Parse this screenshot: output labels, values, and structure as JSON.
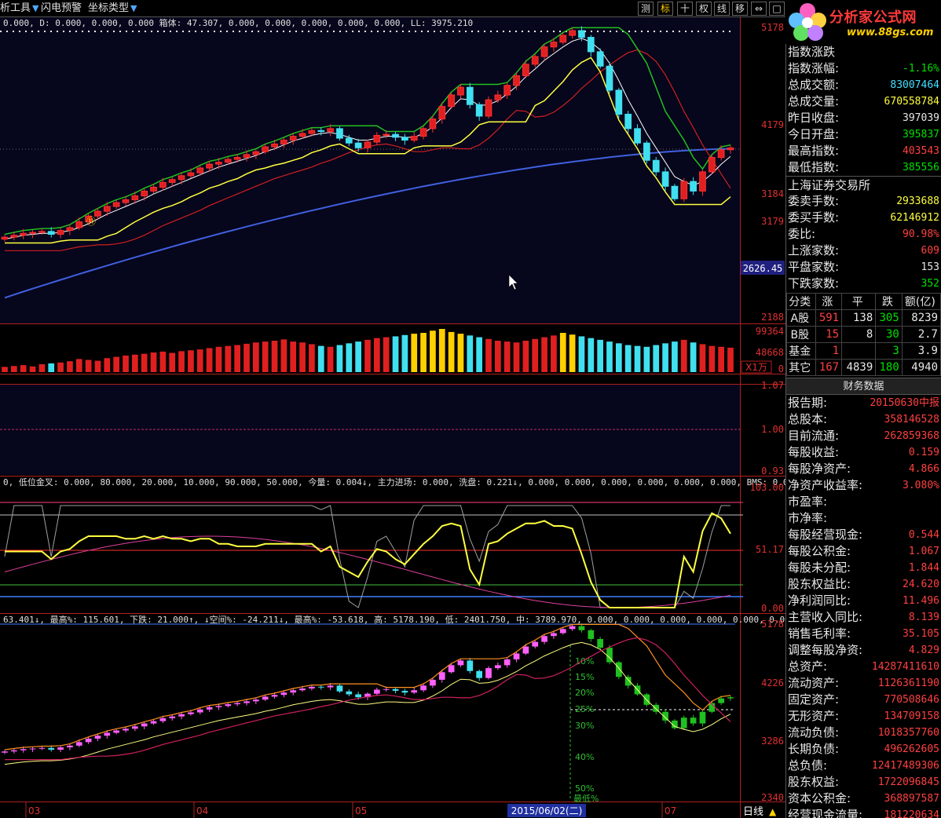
{
  "toolbar": {
    "items": [
      {
        "label": "析工具",
        "caret": true
      },
      {
        "label": "闪电预警",
        "caret": false
      },
      {
        "label": "坐标类型",
        "caret": true
      }
    ],
    "buttons": [
      "测",
      "标",
      "十",
      "权",
      "线",
      "移",
      "⇔",
      "□"
    ]
  },
  "logo": {
    "title": "分析家公式网",
    "url": "www.88gs.com"
  },
  "top_panel": {
    "rows": [
      {
        "label": "指数涨跌",
        "value": "",
        "color": "green"
      },
      {
        "label": "指数涨幅:",
        "value": "-1.16%",
        "color": "green"
      },
      {
        "label": "总成交额:",
        "value": "83007464",
        "color": "cyan"
      },
      {
        "label": "总成交量:",
        "value": "670558784",
        "color": "yel"
      },
      {
        "label": "昨日收盘:",
        "value": "397039",
        "color": "white"
      },
      {
        "label": "今日开盘:",
        "value": "395837",
        "color": "green"
      },
      {
        "label": "最高指数:",
        "value": "403543",
        "color": "red"
      },
      {
        "label": "最低指数:",
        "value": "385556",
        "color": "green"
      }
    ],
    "exchange": "上海证券交易所",
    "rows2": [
      {
        "label": "委卖手数:",
        "value": "2933688",
        "color": "yel"
      },
      {
        "label": "委买手数:",
        "value": "62146912",
        "color": "yel"
      },
      {
        "label": "委比:",
        "value": "90.98%",
        "color": "red"
      },
      {
        "label": "上涨家数:",
        "value": "609",
        "color": "red"
      },
      {
        "label": "平盘家数:",
        "value": "153",
        "color": "white"
      },
      {
        "label": "下跌家数:",
        "value": "352",
        "color": "green"
      }
    ]
  },
  "summary_table": {
    "headers": [
      "分类",
      "涨",
      "平",
      "跌",
      "额(亿)"
    ],
    "rows": [
      [
        "A股",
        "591",
        "138",
        "305",
        "8239"
      ],
      [
        "B股",
        "15",
        "8",
        "30",
        "2.7"
      ],
      [
        "基金",
        "1",
        "",
        "3",
        "3.9"
      ],
      [
        "其它",
        "167",
        "4839",
        "180",
        "4940"
      ]
    ]
  },
  "finance": {
    "tab": "财务数据",
    "rows": [
      {
        "label": "报告期:",
        "value": "20150630中报"
      },
      {
        "label": "总股本:",
        "value": "358146528"
      },
      {
        "label": "目前流通:",
        "value": "262859368"
      },
      {
        "label": "每股收益:",
        "value": "0.159"
      },
      {
        "label": "每股净资产:",
        "value": "4.866"
      },
      {
        "label": "净资产收益率:",
        "value": "3.080%"
      },
      {
        "label": "市盈率:",
        "value": ""
      },
      {
        "label": "市净率:",
        "value": ""
      },
      {
        "label": "每股经营现金:",
        "value": "0.544"
      },
      {
        "label": "每股公积金:",
        "value": "1.067"
      },
      {
        "label": "每股未分配:",
        "value": "1.844"
      },
      {
        "label": "股东权益比:",
        "value": "24.620"
      },
      {
        "label": "净利润同比:",
        "value": "11.496"
      },
      {
        "label": "主营收入同比:",
        "value": "8.139"
      },
      {
        "label": "销售毛利率:",
        "value": "35.105"
      },
      {
        "label": "调整每股净资:",
        "value": "4.829"
      },
      {
        "label": "总资产:",
        "value": "14287411610"
      },
      {
        "label": "流动资产:",
        "value": "1126361190"
      },
      {
        "label": "固定资产:",
        "value": "770508646"
      },
      {
        "label": "无形资产:",
        "value": "134709158"
      },
      {
        "label": "流动负债:",
        "value": "1018357760"
      },
      {
        "label": "长期负债:",
        "value": "496262605"
      },
      {
        "label": "总负债:",
        "value": "12417489306"
      },
      {
        "label": "股东权益:",
        "value": "1722096845"
      },
      {
        "label": "资本公积金:",
        "value": "368897587"
      },
      {
        "label": "经营现金流量:",
        "value": "181220634"
      }
    ]
  },
  "panes": {
    "main": {
      "info": "0.000, D: 0.000, 0.000, 0.000 箱体: 47.307, 0.000, 0.000, 0.000, 0.000, 0.000, LL: 3975.210",
      "y_labels": [
        "5178",
        "4179",
        "3184",
        "3179",
        "2188"
      ],
      "price_tag": "2626.45",
      "marker": "⑪"
    },
    "volume": {
      "y_labels": [
        "99364",
        "48668",
        "0"
      ],
      "unit": "X1万"
    },
    "ratio": {
      "y_labels": [
        "1.07",
        "1.00",
        "0.93"
      ]
    },
    "oscillator": {
      "info": "0, 低位金叉: 0.000, 80.000, 20.000, 10.000, 90.000, 50.000, 今量: 0.004↓, 主力进场: 0.000, 洗盘: 0.221↓, 0.000, 0.000, 0.000, 0.000, 0.000, 0.000, BMS: 0.000",
      "y_labels": [
        "103.00",
        "51.17",
        "0.00"
      ]
    },
    "lower": {
      "info": "63.401↓, 最高%: 115.601, 下跌: 21.000↑, ↓空间%: -24.211↓, 最高%: -53.618, 高: 5178.190, 低: 2401.750, 中: 3789.970, 0.000, 0.000, 0.000, 0.000, 0.000, 0.000, 0",
      "y_labels": [
        "5178",
        "4226",
        "3286",
        "2340"
      ],
      "pct_labels": [
        "10%",
        "15%",
        "20%",
        "25%",
        "30%",
        "40%",
        "50%",
        "最低%"
      ]
    }
  },
  "x_axis": {
    "labels": [
      "03",
      "04",
      "05",
      "07"
    ],
    "cursor_date": "2015/06/02(二)",
    "period": "日线"
  },
  "chart_data": {
    "type": "candlestick",
    "title": "",
    "y_range": [
      2188,
      5178
    ],
    "closes": [
      3020,
      3040,
      3060,
      3070,
      3080,
      3050,
      3090,
      3120,
      3180,
      3240,
      3290,
      3340,
      3380,
      3410,
      3450,
      3500,
      3540,
      3590,
      3620,
      3660,
      3690,
      3740,
      3780,
      3800,
      3830,
      3850,
      3880,
      3910,
      3960,
      3990,
      4030,
      4070,
      4100,
      4130,
      4120,
      4150,
      4050,
      4000,
      3950,
      4010,
      4080,
      4090,
      4060,
      4030,
      4070,
      4150,
      4250,
      4380,
      4500,
      4580,
      4400,
      4280,
      4450,
      4500,
      4600,
      4700,
      4820,
      4900,
      5000,
      5050,
      5120,
      5170,
      5100,
      4950,
      4800,
      4550,
      4300,
      4150,
      4000,
      3820,
      3700,
      3550,
      3420,
      3600,
      3500,
      3700,
      3850,
      3930,
      3950
    ],
    "volumes": [
      12,
      14,
      16,
      13,
      18,
      20,
      22,
      25,
      30,
      28,
      26,
      32,
      35,
      38,
      40,
      42,
      45,
      47,
      44,
      48,
      50,
      52,
      55,
      58,
      60,
      62,
      65,
      68,
      70,
      72,
      75,
      70,
      68,
      64,
      60,
      58,
      62,
      66,
      70,
      74,
      78,
      80,
      82,
      85,
      88,
      90,
      95,
      99,
      92,
      88,
      84,
      80,
      76,
      72,
      70,
      68,
      72,
      76,
      80,
      84,
      90,
      86,
      82,
      78,
      74,
      70,
      66,
      62,
      60,
      58,
      62,
      66,
      70,
      74,
      68,
      64,
      60,
      58,
      56
    ],
    "ma_white": [
      3000,
      3020,
      3040,
      3050,
      3060,
      3060,
      3070,
      3090,
      3120,
      3160,
      3210,
      3260,
      3300,
      3340,
      3380,
      3420,
      3470,
      3510,
      3550,
      3590,
      3630,
      3670,
      3710,
      3750,
      3780,
      3810,
      3840,
      3870,
      3910,
      3940,
      3980,
      4020,
      4050,
      4080,
      4100,
      4110,
      4090,
      4060,
      4030,
      4030,
      4050,
      4070,
      4070,
      4060,
      4060,
      4100,
      4170,
      4260,
      4370,
      4460,
      4450,
      4390,
      4400,
      4440,
      4510,
      4590,
      4690,
      4770,
      4860,
      4930,
      5000,
      5060,
      5090,
      5050,
      4970,
      4830,
      4650,
      4450,
      4280,
      4100,
      3950,
      3800,
      3650,
      3600,
      3560,
      3600,
      3680,
      3780,
      3860
    ],
    "ma_blue_range": [
      2390,
      3940
    ]
  }
}
